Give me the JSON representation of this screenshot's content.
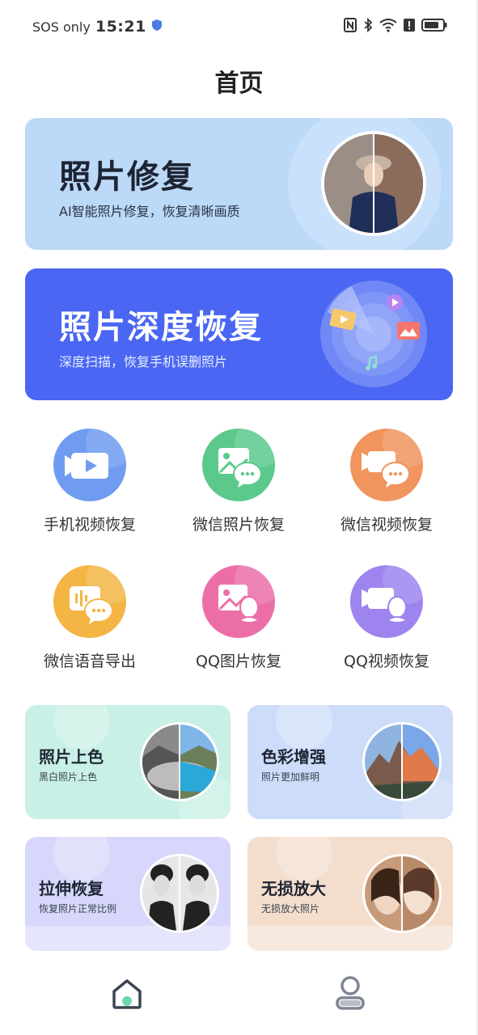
{
  "status_bar": {
    "carrier": "SOS only",
    "time": "15:21",
    "icons": [
      "shield-icon",
      "nfc-icon",
      "bluetooth-icon",
      "wifi-icon",
      "alert-icon",
      "battery-icon"
    ]
  },
  "header": {
    "title": "首页"
  },
  "banners": [
    {
      "title": "照片修复",
      "subtitle": "AI智能照片修复，恢复清晰画质"
    },
    {
      "title": "照片深度恢复",
      "subtitle": "深度扫描，恢复手机误删照片"
    }
  ],
  "grid": [
    {
      "label": "手机视频恢复",
      "icon": "video-icon",
      "color": "#6f9cf1"
    },
    {
      "label": "微信照片恢复",
      "icon": "wechat-photo-icon",
      "color": "#5cc98c"
    },
    {
      "label": "微信视频恢复",
      "icon": "wechat-video-icon",
      "color": "#f0955e"
    },
    {
      "label": "微信语音导出",
      "icon": "wechat-voice-icon",
      "color": "#f4b545"
    },
    {
      "label": "QQ图片恢复",
      "icon": "qq-photo-icon",
      "color": "#ec6ea8"
    },
    {
      "label": "QQ视频恢复",
      "icon": "qq-video-icon",
      "color": "#9d84ef"
    }
  ],
  "cards": [
    {
      "title": "照片上色",
      "subtitle": "黑白照片上色",
      "color": "#c8f0e6"
    },
    {
      "title": "色彩增强",
      "subtitle": "照片更加鲜明",
      "color": "#cddcf8"
    },
    {
      "title": "拉伸恢复",
      "subtitle": "恢复照片正常比例",
      "color": "#d7d7fb"
    },
    {
      "title": "无损放大",
      "subtitle": "无损放大照片",
      "color": "#f3ddcc"
    }
  ],
  "bottom_nav": [
    {
      "name": "home",
      "icon": "home-icon",
      "active": true
    },
    {
      "name": "profile",
      "icon": "profile-icon",
      "active": false
    }
  ]
}
